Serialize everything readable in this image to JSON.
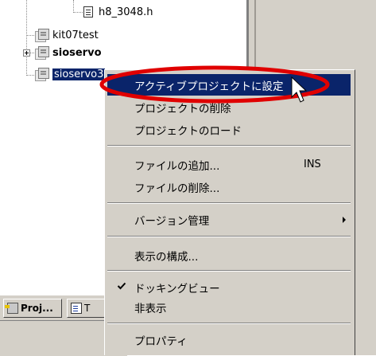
{
  "tree": {
    "nodes": [
      {
        "label": "h8_3048.h",
        "type": "file"
      },
      {
        "label": "kit07test",
        "type": "project"
      },
      {
        "label": "sioservo",
        "type": "project"
      },
      {
        "label": "sioservo3",
        "type": "project"
      }
    ]
  },
  "tabs": [
    {
      "label": "Proj...",
      "icon": "project-icon"
    },
    {
      "label": "T",
      "icon": "file-icon"
    }
  ],
  "menu": {
    "items": [
      {
        "label": "アクティブプロジェクトに設定",
        "active": true
      },
      {
        "label": "プロジェクトの削除"
      },
      {
        "label": "プロジェクトのロード"
      },
      {
        "label": "ファイルの追加...",
        "shortcut": "INS"
      },
      {
        "label": "ファイルの削除..."
      },
      {
        "label": "バージョン管理",
        "submenu": true
      },
      {
        "label": "表示の構成..."
      },
      {
        "label": "ドッキングビュー",
        "checked": true
      },
      {
        "label": "非表示"
      },
      {
        "label": "プロパティ"
      }
    ]
  },
  "colors": {
    "highlight": "#0a246a",
    "annotation": "#e00000",
    "menu_bg": "#d4d0c8"
  }
}
